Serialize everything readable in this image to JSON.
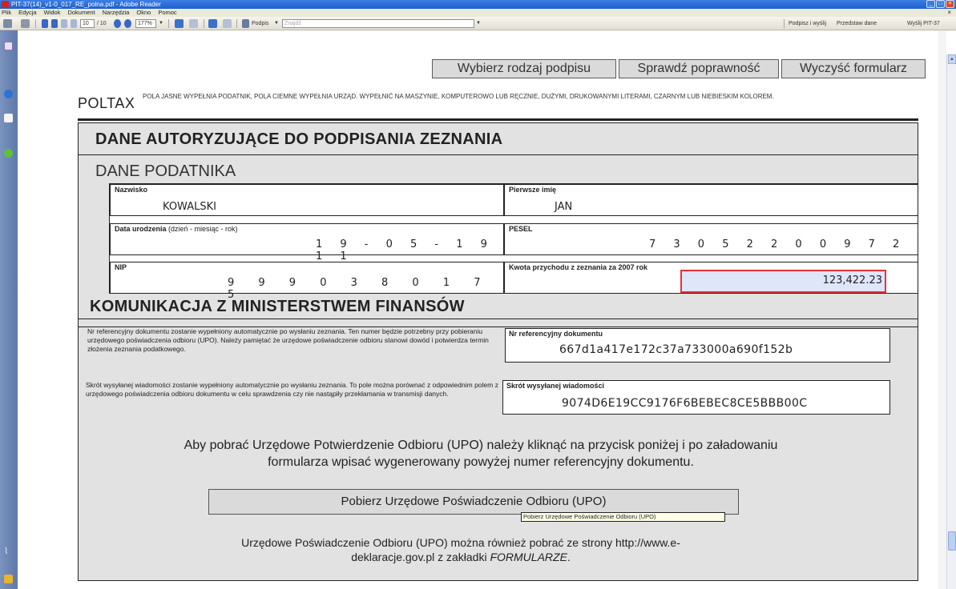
{
  "window": {
    "title": "PIT-37(14)_v1-0_017_RE_polna.pdf - Adobe Reader"
  },
  "menu": {
    "items": [
      "Plik",
      "Edycja",
      "Widok",
      "Dokument",
      "Narzędzia",
      "Okno",
      "Pomoc"
    ]
  },
  "toolbar": {
    "page_current": "10",
    "page_total": "/ 10",
    "zoom": "177%",
    "sign_label": "Podpis",
    "find_placeholder": "Znajdź",
    "right_links": [
      "Podpisz i wyślij",
      "Przedstaw dane",
      "Wyślij PIT-37"
    ]
  },
  "form_buttons": {
    "choose_signature": "Wybierz rodzaj podpisu",
    "check": "Sprawdź poprawność",
    "clear": "Wyczyść formularz"
  },
  "header": {
    "brand": "POLTAX",
    "instructions": "POLA JASNE WYPEŁNIA PODATNIK, POLA CIEMNE WYPEŁNIA URZĄD. WYPEŁNIĆ NA MASZYNIE, KOMPUTEROWO LUB RĘCZNIE, DUŻYMI, DRUKOWANYMI LITERAMI, CZARNYM LUB NIEBIESKIM KOLOREM."
  },
  "section_auth": {
    "title": "DANE AUTORYZUJĄCE DO PODPISANIA ZEZNANIA"
  },
  "section_taxpayer": {
    "title": "DANE PODATNIKA",
    "surname_label": "Nazwisko",
    "surname": "KOWALSKI",
    "firstname_label": "Pierwsze imię",
    "firstname": "JAN",
    "birth_label": "Data urodzenia",
    "birth_hint": "(dzień - miesiąc - rok)",
    "birth_value": "1 9 - 0 5 - 1 9 1 1",
    "pesel_label": "PESEL",
    "pesel_value": "7 3 0 5 2 2 0 0 9 7 2",
    "nip_label": "NIP",
    "nip_value": "9 9 9 0 3 8 0 1 7 5",
    "income_label": "Kwota przychodu z zeznania za 2007 rok",
    "income_value": "123,422.23"
  },
  "section_ministry": {
    "title": "KOMUNIKACJA Z MINISTERSTWEM FINANSÓW",
    "note_ref": "Nr referencyjny dokumentu zostanie wypełniony automatycznie po wysłaniu zeznania. Ten numer będzie potrzebny przy pobieraniu urzędowego poświadczenia odbioru (UPO). Należy pamiętać że urzędowe poświadczenie odbioru stanowi dowód i potwierdza termin złożenia zeznania podatkowego.",
    "ref_label": "Nr referencyjny dokumentu",
    "ref_value": "667d1a417e172c37a733000a690f152b",
    "note_hash": "Skrót wysyłanej wiadomości zostanie wypełniony automatycznie po wysłaniu zeznania. To pole można porównać z odpowiednim polem z urzędowego poświadczenia odbioru dokumentu w celu sprawdzenia czy nie nastąpiły przekłamania w transmisji danych.",
    "hash_label": "Skrót wysyłanej wiadomości",
    "hash_value": "9074D6E19CC9176F6BEBEC8CE5BBB00C",
    "info": "Aby pobrać Urzędowe Potwierdzenie Odbioru (UPO) należy kliknąć na przycisk poniżej i po załadowaniu formularza wpisać wygenerowany powyżej numer referencyjny dokumentu.",
    "upo_button": "Pobierz Urzędowe Poświadczenie Odbioru (UPO)",
    "tooltip": "Pobierz Urzędowe Poświadczenie Odbioru (UPO)",
    "footer_text": "Urzędowe Poświadczenie Odbioru (UPO) można również pobrać ze strony http://www.e-deklaracje.gov.pl z zakładki",
    "footer_em": "FORMULARZE",
    "footer_dot": "."
  },
  "colors": {
    "highlight_border": "#e5333a",
    "highlight_fill": "#dfe6fa",
    "titlebar": "#1f5fc9"
  }
}
